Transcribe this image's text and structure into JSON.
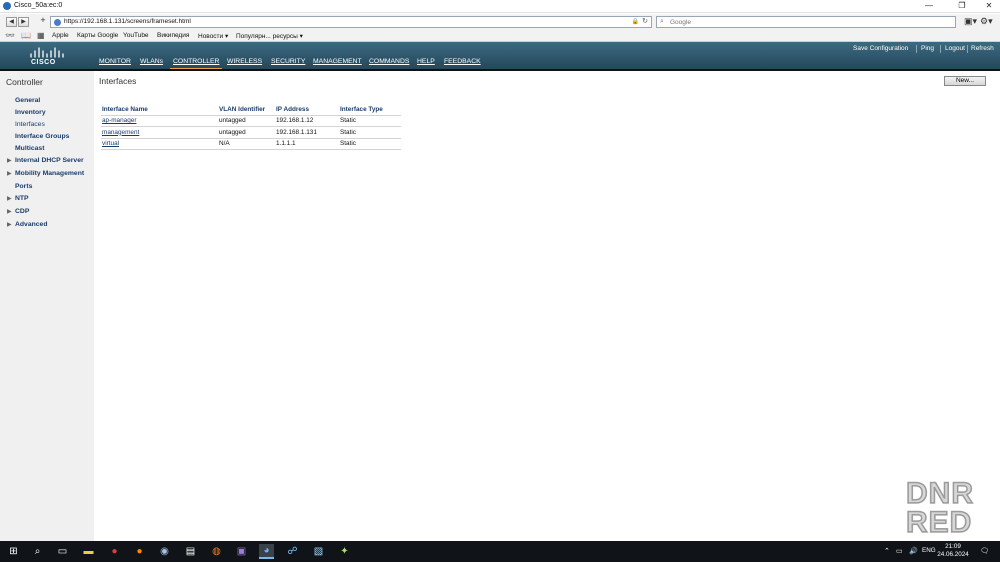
{
  "window": {
    "title": "Cisco_50a:ec:0",
    "controls": {
      "minimize": "—",
      "maximize": "❐",
      "close": "✕"
    }
  },
  "browser": {
    "url": "https://192.168.1.131/screens/frameset.html",
    "search_placeholder": "Google",
    "bookmarks": [
      "Apple",
      "Карты Google",
      "YouTube",
      "Википедия",
      "Новости ▾",
      "Популярн... ресурсы ▾"
    ]
  },
  "header": {
    "logo_text": "CISCO",
    "menu": [
      "MONITOR",
      "WLANs",
      "CONTROLLER",
      "WIRELESS",
      "SECURITY",
      "MANAGEMENT",
      "COMMANDS",
      "HELP",
      "FEEDBACK"
    ],
    "active_menu": "CONTROLLER",
    "links": [
      "Save Configuration",
      "Ping",
      "Logout",
      "Refresh"
    ]
  },
  "sidebar": {
    "heading": "Controller",
    "items": [
      {
        "label": "General",
        "expandable": false
      },
      {
        "label": "Inventory",
        "expandable": false
      },
      {
        "label": "Interfaces",
        "expandable": false,
        "current": true
      },
      {
        "label": "Interface Groups",
        "expandable": false
      },
      {
        "label": "Multicast",
        "expandable": false
      },
      {
        "label": "Internal DHCP Server",
        "expandable": true
      },
      {
        "label": "Mobility Management",
        "expandable": true
      },
      {
        "label": "Ports",
        "expandable": false
      },
      {
        "label": "NTP",
        "expandable": true
      },
      {
        "label": "CDP",
        "expandable": true
      },
      {
        "label": "Advanced",
        "expandable": true
      }
    ]
  },
  "main": {
    "title": "Interfaces",
    "new_button": "New...",
    "table": {
      "headers": [
        "Interface Name",
        "VLAN Identifier",
        "IP Address",
        "Interface Type"
      ],
      "rows": [
        [
          "ap-manager",
          "untagged",
          "192.168.1.12",
          "Static"
        ],
        [
          "management",
          "untagged",
          "192.168.1.131",
          "Static"
        ],
        [
          "virtual",
          "N/A",
          "1.1.1.1",
          "Static"
        ]
      ]
    }
  },
  "watermark": [
    "DNR",
    "RED"
  ],
  "taskbar": {
    "language": "ENG",
    "time": "21:09",
    "date": "24.06.2024"
  },
  "colors": {
    "header_bg": "#2d5469",
    "active_tab_accent": "#e8a33d",
    "link": "#1a3c6c",
    "sidebar_bg": "#f0f0f0",
    "taskbar_bg": "#101418"
  }
}
